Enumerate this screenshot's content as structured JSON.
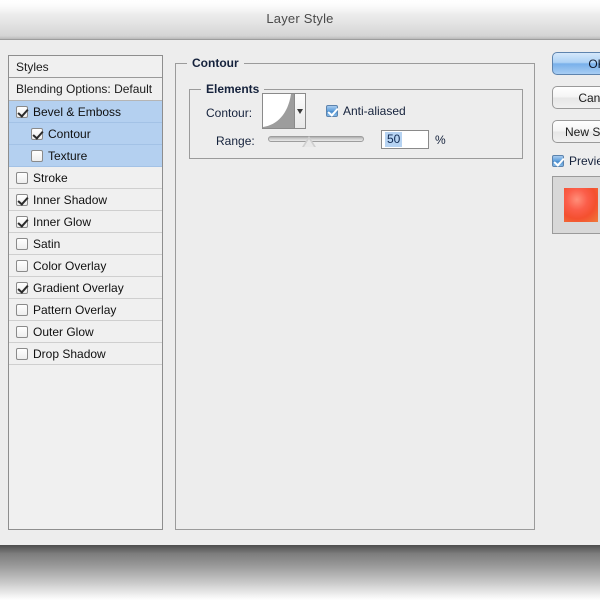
{
  "window": {
    "title": "Layer Style"
  },
  "styles_panel": {
    "header": "Styles",
    "blending_options": "Blending Options: Default",
    "effects": [
      {
        "label": "Bevel & Emboss",
        "checked": true,
        "selected": true,
        "indent": false
      },
      {
        "label": "Contour",
        "checked": true,
        "selected": true,
        "indent": true
      },
      {
        "label": "Texture",
        "checked": false,
        "selected": true,
        "indent": true
      },
      {
        "label": "Stroke",
        "checked": false,
        "selected": false,
        "indent": false
      },
      {
        "label": "Inner Shadow",
        "checked": true,
        "selected": false,
        "indent": false
      },
      {
        "label": "Inner Glow",
        "checked": true,
        "selected": false,
        "indent": false
      },
      {
        "label": "Satin",
        "checked": false,
        "selected": false,
        "indent": false
      },
      {
        "label": "Color Overlay",
        "checked": false,
        "selected": false,
        "indent": false
      },
      {
        "label": "Gradient Overlay",
        "checked": true,
        "selected": false,
        "indent": false
      },
      {
        "label": "Pattern Overlay",
        "checked": false,
        "selected": false,
        "indent": false
      },
      {
        "label": "Outer Glow",
        "checked": false,
        "selected": false,
        "indent": false
      },
      {
        "label": "Drop Shadow",
        "checked": false,
        "selected": false,
        "indent": false
      }
    ]
  },
  "contour_panel": {
    "group_title": "Contour",
    "elements_title": "Elements",
    "contour_label": "Contour:",
    "contour_preset_icon": "contour-curve-thumbnail",
    "anti_aliased_label": "Anti-aliased",
    "anti_aliased_checked": true,
    "range_label": "Range:",
    "range_value": "50",
    "range_unit": "%",
    "range_slider_percent": 42
  },
  "actions": {
    "ok_label": "OK",
    "cancel_label": "Cancel",
    "new_style_label": "New Style...",
    "preview_label": "Preview",
    "preview_checked": true
  },
  "colors": {
    "selection_blue": "#b4d0f0",
    "default_button_blue": "#79b0ea",
    "preview_swatch": "#f4502f",
    "dialog_background": "#ededed"
  }
}
